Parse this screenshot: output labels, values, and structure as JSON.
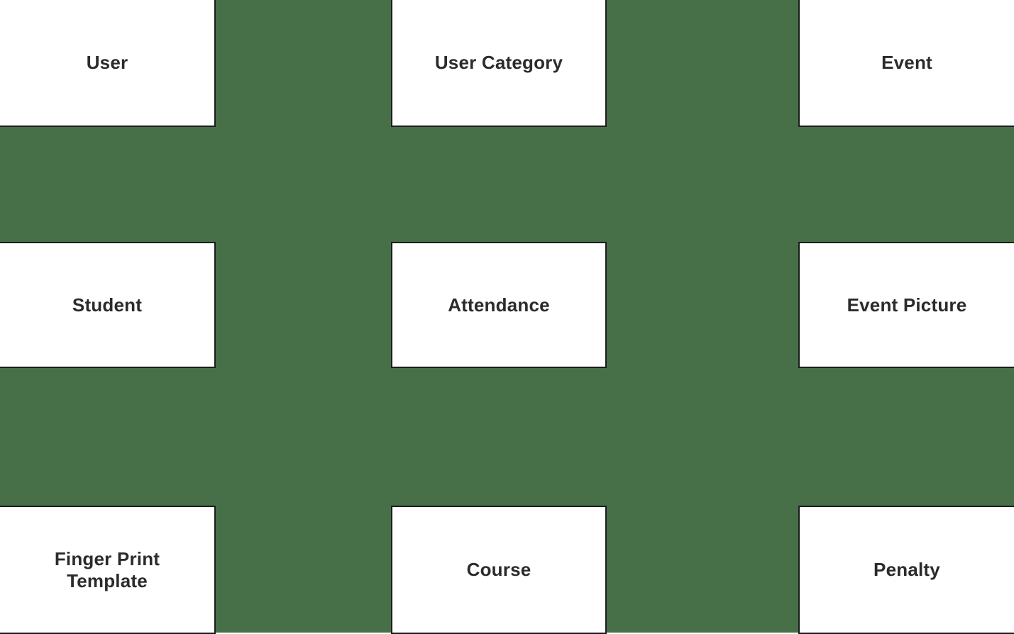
{
  "diagram": {
    "background_color": "#477049",
    "box_fill_color": "#ffffff",
    "box_border_color": "#1c1c1c",
    "label_color": "#2b2b2b",
    "grid": {
      "rows": 3,
      "columns": 3
    },
    "entities": [
      {
        "id": "user",
        "label": "User",
        "row": 1,
        "column": 1
      },
      {
        "id": "user-category",
        "label": "User Category",
        "row": 1,
        "column": 2
      },
      {
        "id": "event",
        "label": "Event",
        "row": 1,
        "column": 3
      },
      {
        "id": "student",
        "label": "Student",
        "row": 2,
        "column": 1
      },
      {
        "id": "attendance",
        "label": "Attendance",
        "row": 2,
        "column": 2
      },
      {
        "id": "event-picture",
        "label": "Event Picture",
        "row": 2,
        "column": 3
      },
      {
        "id": "finger-print-template",
        "label": "Finger Print\nTemplate",
        "row": 3,
        "column": 1
      },
      {
        "id": "course",
        "label": "Course",
        "row": 3,
        "column": 2
      },
      {
        "id": "penalty",
        "label": "Penalty",
        "row": 3,
        "column": 3
      }
    ]
  }
}
